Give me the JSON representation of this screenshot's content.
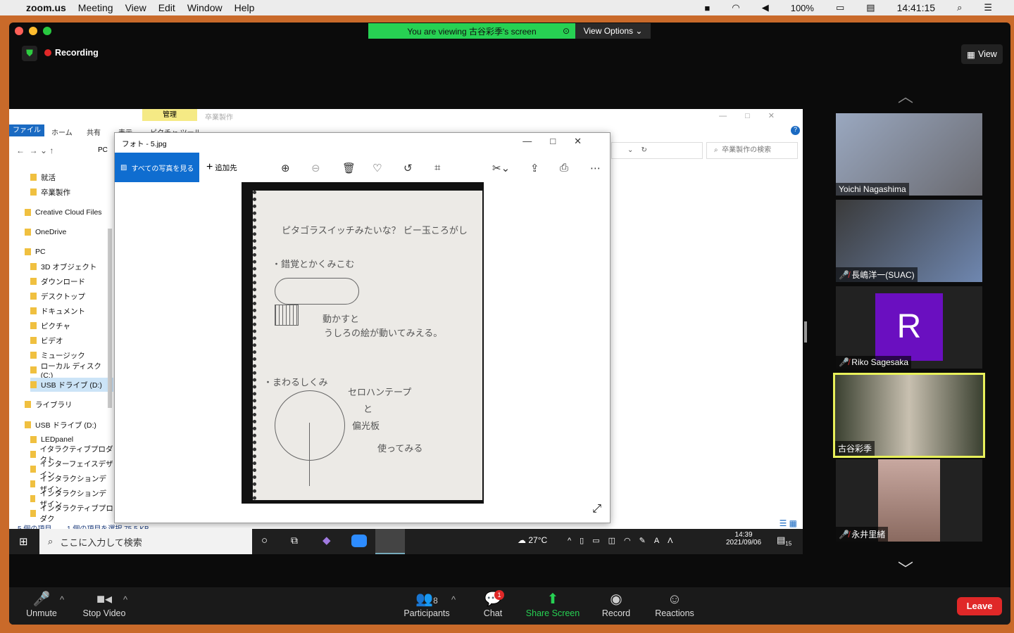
{
  "menubar": {
    "app": "zoom.us",
    "items": [
      "Meeting",
      "View",
      "Edit",
      "Window",
      "Help"
    ],
    "battery": "100%",
    "time": "14:41:15"
  },
  "zoom": {
    "banner": "You are viewing 古谷彩季's screen",
    "view_options": "View Options",
    "recording": "Recording",
    "view": "View"
  },
  "explorer": {
    "qa_tab": "管理",
    "title": "卒業製作",
    "tabs": [
      "ファイル",
      "ホーム",
      "共有",
      "表示",
      "ピクチャ ツール"
    ],
    "path": "PC",
    "search_placeholder": "卒業製作の検索",
    "nav": [
      "就活",
      "卒業製作",
      "Creative Cloud Files",
      "OneDrive",
      "PC",
      "3D オブジェクト",
      "ダウンロード",
      "デスクトップ",
      "ドキュメント",
      "ピクチャ",
      "ビデオ",
      "ミュージック",
      "ローカル ディスク (C:)",
      "USB ドライブ (D:)",
      "ライブラリ",
      "USB ドライブ (D:)",
      "LEDpanel",
      "イタラクティブプロダクト",
      "インターフェイスデザイン",
      "インタラクションデザイン",
      "インタラクションデザイン",
      "インタラクティブプロダク"
    ],
    "status_count": "5 個の項目",
    "status_selected": "1 個の項目を選択 75.5 KB"
  },
  "photos": {
    "title": "フォト - 5.jpg",
    "see_all": "すべての写真を見る",
    "add_to": "追加先"
  },
  "note": {
    "lines": [
      "ピタゴラスイッチみたいな？ ビー玉ころがし",
      "・錯覚とかくみこむ",
      "動かすと",
      "うしろの絵が動いてみえる。",
      "・まわるしくみ",
      "セロハンテープ",
      "と",
      "偏光板",
      "使ってみる"
    ]
  },
  "taskbar": {
    "search": "ここに入力して検索",
    "weather": "27°C",
    "time": "14:39",
    "date": "2021/09/06",
    "notif": "15"
  },
  "participants": [
    {
      "name": "Yoichi Nagashima"
    },
    {
      "name": "長嶋洋一(SUAC)"
    },
    {
      "name": "Riko Sagesaka",
      "initial": "R"
    },
    {
      "name": "古谷彩季"
    },
    {
      "name": "永井里緒"
    }
  ],
  "toolbar": {
    "unmute": "Unmute",
    "stop_video": "Stop Video",
    "participants": "Participants",
    "participant_count": "8",
    "chat": "Chat",
    "chat_badge": "1",
    "share": "Share Screen",
    "record": "Record",
    "reactions": "Reactions",
    "leave": "Leave"
  }
}
